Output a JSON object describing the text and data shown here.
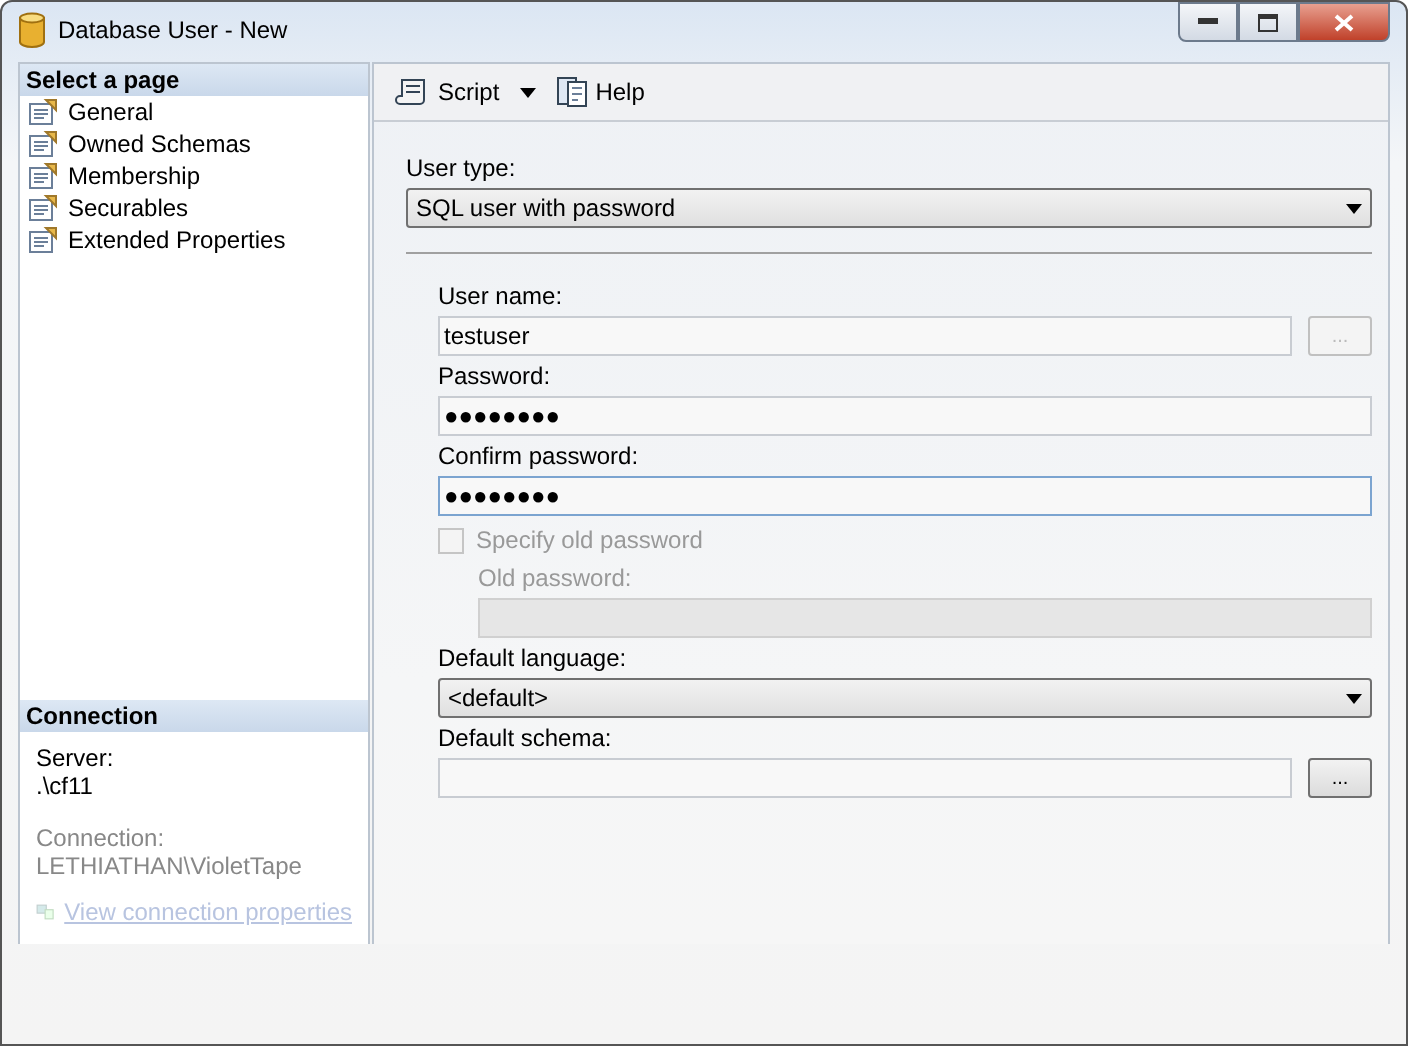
{
  "window": {
    "title": "Database User - New"
  },
  "sidebar": {
    "header": "Select a page",
    "items": [
      {
        "label": "General",
        "selected": false
      },
      {
        "label": "Owned Schemas",
        "selected": false
      },
      {
        "label": "Membership",
        "selected": false
      },
      {
        "label": "Securables",
        "selected": false
      },
      {
        "label": "Extended Properties",
        "selected": false
      }
    ]
  },
  "connection": {
    "header": "Connection",
    "server_label": "Server:",
    "server": ".\\cf11",
    "connection_label": "Connection:",
    "connection": "LETHIATHAN\\VioletTape",
    "link": {
      "label": "View connection properties",
      "disabled": true
    }
  },
  "toolbar": [
    {
      "kind": "script",
      "label": "Script"
    },
    {
      "kind": "help",
      "label": "Help"
    }
  ],
  "form": {
    "user_type": {
      "label": "User type:",
      "value": "SQL user with password"
    },
    "fields": [
      {
        "kind": "text",
        "label": "User name:",
        "value": "testuser",
        "browse": {
          "label": "...",
          "disabled": true
        },
        "disabled": false,
        "focused": false
      },
      {
        "kind": "text",
        "label": "Password:",
        "value": "●●●●●●●●",
        "disabled": false,
        "focused": false
      },
      {
        "kind": "text",
        "label": "Confirm password:",
        "value": "●●●●●●●●",
        "disabled": false,
        "focused": true
      },
      {
        "kind": "checkbox",
        "label": "Specify old password",
        "checked": false,
        "disabled": true
      },
      {
        "kind": "text",
        "label": "Old password:",
        "indent": true,
        "disabled": true,
        "focused": false
      },
      {
        "kind": "select",
        "label": "Default language:",
        "value": "<default>"
      },
      {
        "kind": "text",
        "label": "Default schema:",
        "browse": {
          "label": "...",
          "disabled": false
        },
        "disabled": false,
        "focused": false
      }
    ]
  }
}
